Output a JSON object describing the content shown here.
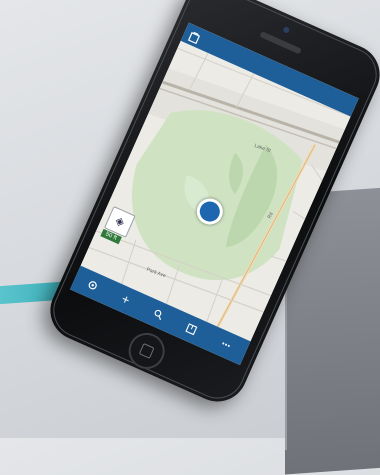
{
  "app": {
    "top_bar": {
      "icon": "map-layers-icon"
    },
    "bottom_bar": {
      "items": [
        {
          "icon": "settings-icon"
        },
        {
          "icon": "add-icon",
          "label": "+"
        },
        {
          "icon": "search-icon"
        },
        {
          "icon": "bookmark-icon"
        },
        {
          "icon": "more-icon"
        }
      ]
    },
    "map": {
      "badge_label": "50 ft",
      "street_labels": [
        "Lake St",
        "Park Ave",
        "Rd"
      ]
    }
  },
  "colors": {
    "bar": "#1f5f99",
    "park": "#cfe3c2",
    "location": "#1f66b0",
    "accent_teal": "#3aaeb8"
  }
}
